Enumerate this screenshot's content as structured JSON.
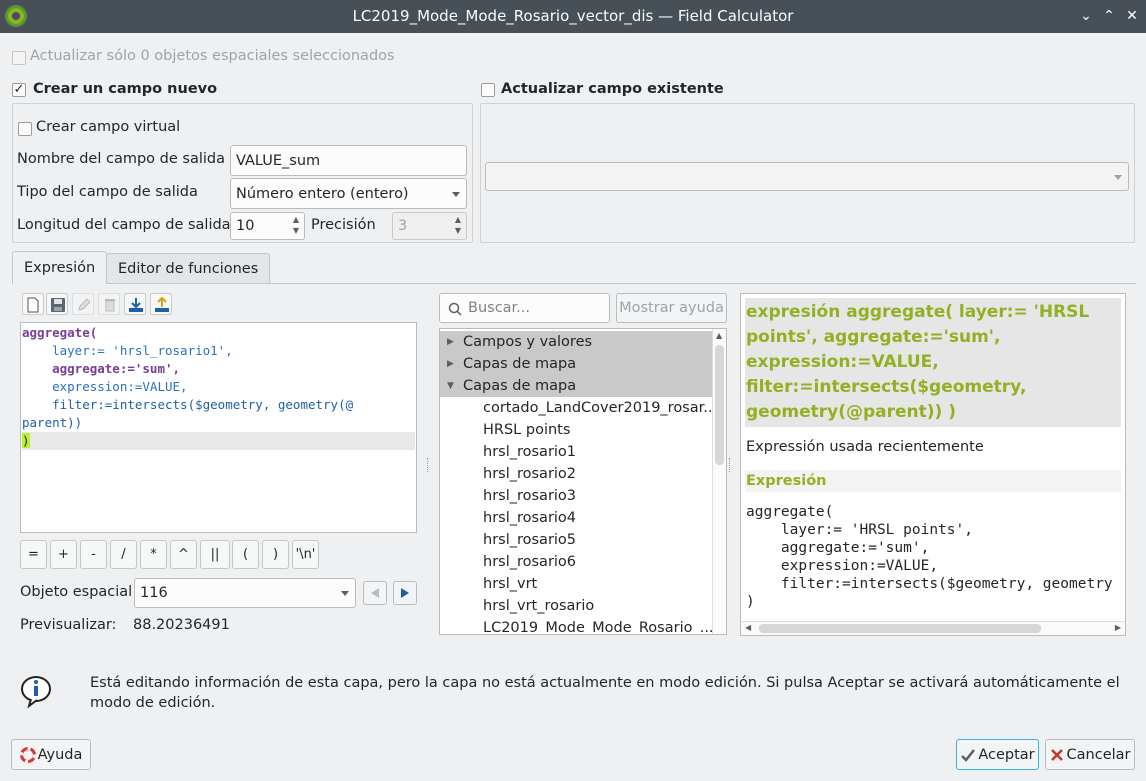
{
  "window": {
    "title": "LC2019_Mode_Mode_Rosario_vector_dis — Field Calculator",
    "buttons": {
      "minimize": "⌄",
      "maximize": "⌃",
      "close": "✕"
    }
  },
  "top": {
    "update_selected_label": "Actualizar sólo 0 objetos espaciales seleccionados",
    "update_selected_checked": false,
    "create_new_label": "Crear un campo nuevo",
    "create_new_checked": true,
    "update_existing_label": "Actualizar campo existente",
    "update_existing_checked": false
  },
  "new_field": {
    "virtual_label": "Crear campo virtual",
    "name_label": "Nombre del campo de salida",
    "name_value": "VALUE_sum",
    "type_label": "Tipo del campo de salida",
    "type_value": "Número entero (entero)",
    "length_label": "Longitud del campo de salida",
    "length_value": "10",
    "precision_label": "Precisión",
    "precision_value": "3"
  },
  "existing_field": {
    "value": ""
  },
  "tabs": [
    {
      "label": "Expresión",
      "active": true
    },
    {
      "label": "Editor de funciones",
      "active": false
    }
  ],
  "toolbar_icons": [
    "new-file-icon",
    "save-icon",
    "edit-icon",
    "delete-icon",
    "import-icon",
    "export-icon"
  ],
  "editor": {
    "lines": [
      "aggregate(",
      "    layer:= 'hrsl_rosario1',",
      "    aggregate:='sum',",
      "    expression:=VALUE,",
      "    filter:=intersects($geometry, geometry(@",
      "parent))",
      ")"
    ]
  },
  "operators": [
    "=",
    "+",
    "-",
    "/",
    "*",
    "^",
    "||",
    "(",
    ")",
    "'\\n'"
  ],
  "feature": {
    "label": "Objeto espacial",
    "value": "116",
    "preview_label": "Previsualizar:",
    "preview_value": "88.20236491"
  },
  "search": {
    "placeholder": "Buscar...",
    "help_button": "Mostrar ayuda"
  },
  "tree": {
    "groups": [
      {
        "label": "Campos y valores",
        "expanded": false
      },
      {
        "label": "Capas de mapa",
        "expanded": false
      },
      {
        "label": "Capas de mapa",
        "expanded": true
      }
    ],
    "items": [
      "cortado_LandCover2019_rosar...",
      "HRSL points",
      "hrsl_rosario1",
      "hrsl_rosario2",
      "hrsl_rosario3",
      "hrsl_rosario4",
      "hrsl_rosario5",
      "hrsl_rosario6",
      "hrsl_vrt",
      "hrsl_vrt_rosario",
      "LC2019_Mode_Mode_Rosario_..."
    ]
  },
  "help": {
    "header": "expresión aggregate( layer:= 'HRSL points', aggregate:='sum', expression:=VALUE, filter:=intersects($geometry, geometry(@parent)) )",
    "recent_label": "Expressión usada recientemente",
    "section_label": "Expresión",
    "code_lines": [
      "aggregate(",
      "    layer:= 'HRSL points',",
      "    aggregate:='sum',",
      "    expression:=VALUE,",
      "    filter:=intersects($geometry, geometry",
      ")"
    ]
  },
  "info": {
    "message": "Está editando información de esta capa, pero la capa no está actualmente en modo edición. Si pulsa Aceptar se activará automáticamente el modo de edición."
  },
  "footer": {
    "help_button": "Ayuda",
    "ok_button": "Aceptar",
    "cancel_button": "Cancelar"
  },
  "colors": {
    "titlebar": "#475057",
    "accent_green": "#93b023",
    "window_bg": "#eff0f1",
    "focus_blue": "#3daee9"
  }
}
